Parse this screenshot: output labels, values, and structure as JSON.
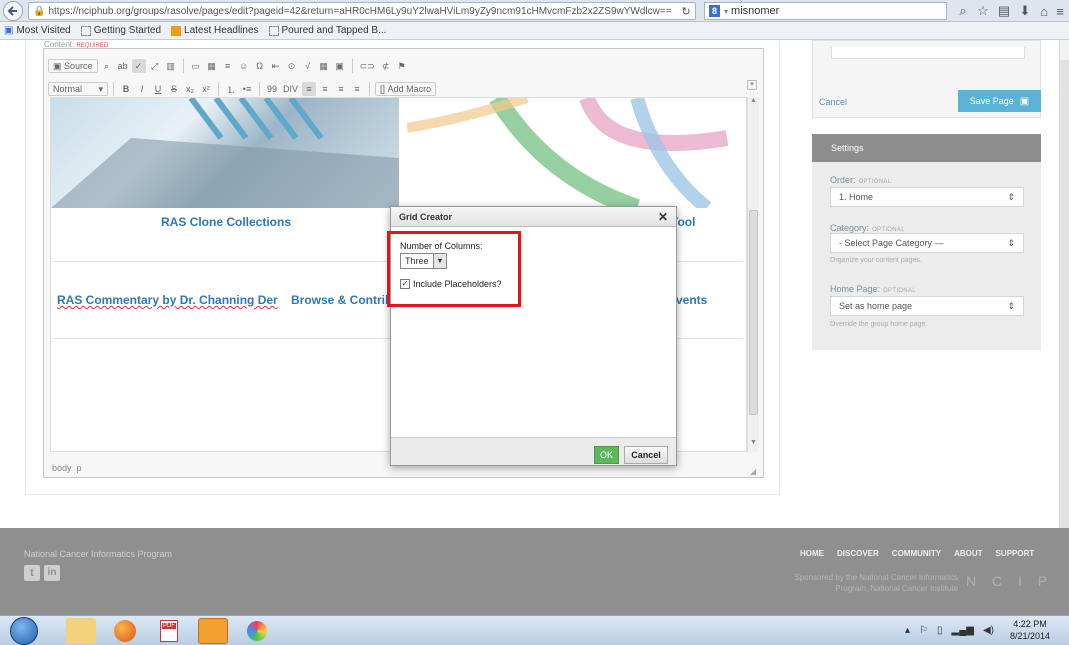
{
  "browser": {
    "url": "https://nciphub.org/groups/rasolve/pages/edit?pageid=42&return=aHR0cHM6Ly9uY2lwaHViLm9yZy9ncm91cHMvcmFzb2x2ZS9wYWdlcw==",
    "url_host": "nciphub.org",
    "search_text": "misnomer",
    "bookmarks": [
      "Most Visited",
      "Getting Started",
      "Latest Headlines",
      "Poured and Tapped B..."
    ]
  },
  "editor": {
    "content_label": "Content:",
    "required": "REQUIRED",
    "toolbar_row1": [
      "Source"
    ],
    "format_select": "Normal",
    "add_macro": "Add Macro",
    "statusbar": "body  p"
  },
  "content": {
    "link1": "RAS Clone Collections",
    "link2": "Tool",
    "link3": "RAS Commentary by Dr. Channing Der",
    "link4": "Browse & Contribu",
    "link5": "vents"
  },
  "dialog": {
    "title": "Grid Creator",
    "columns_label": "Number of Columns:",
    "columns_value": "Three",
    "placeholders_label": "Include Placeholders?",
    "ok": "OK",
    "cancel": "Cancel"
  },
  "actions": {
    "cancel": "Cancel",
    "save": "Save Page"
  },
  "settings": {
    "title": "Settings",
    "order_label": "Order:",
    "order_opt": "OPTIONAL",
    "order_value": "1. Home",
    "category_label": "Category:",
    "category_opt": "OPTIONAL",
    "category_value": "- Select Page Category —",
    "category_hint": "Organize your content pages.",
    "home_label": "Home Page:",
    "home_opt": "OPTIONAL",
    "home_value": "Set as home page",
    "home_hint": "Override the group home page."
  },
  "footer": {
    "org": "National Cancer Informatics Program",
    "nav": [
      "HOME",
      "DISCOVER",
      "COMMUNITY",
      "ABOUT",
      "SUPPORT"
    ],
    "sponsor_line1": "Sponsored by the National Cancer Informatics",
    "sponsor_line2": "Program, National Cancer Institute",
    "logo_text": "N C I P"
  },
  "taskbar": {
    "time": "4:22 PM",
    "date": "8/21/2014"
  },
  "colors": {
    "link": "#2b79b5",
    "save_button": "#5bb3d6",
    "ok_button": "#5cb85c",
    "highlight_box": "#e3141b",
    "footer": "#8f8f8f"
  }
}
